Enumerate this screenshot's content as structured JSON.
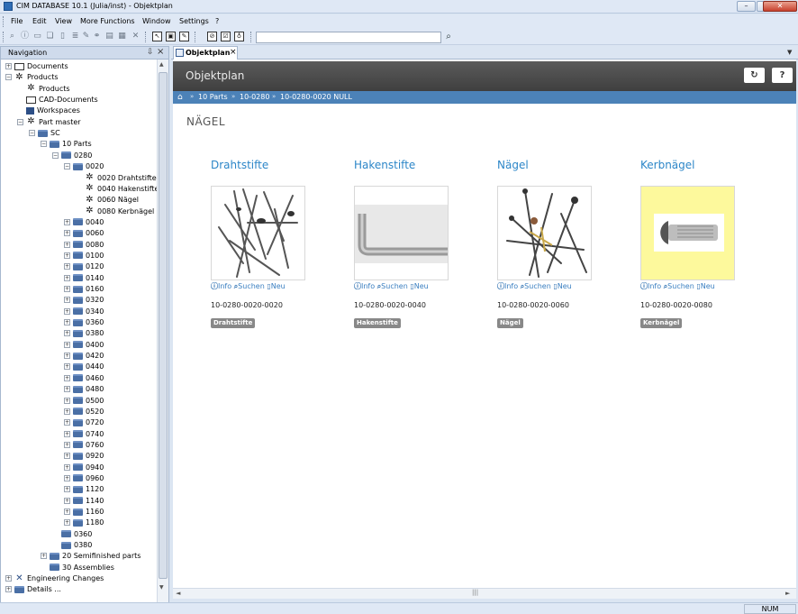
{
  "window": {
    "title": "CIM DATABASE 10.1 (Julia/inst) - Objektplan"
  },
  "menu": [
    "File",
    "Edit",
    "View",
    "More Functions",
    "Window",
    "Settings",
    "?"
  ],
  "toolbar": {
    "search_value": ""
  },
  "navigation": {
    "title": "Navigation",
    "nodes": [
      {
        "label": "Documents",
        "icon": "document-icon"
      },
      {
        "label": "Products",
        "icon": "gears-icon"
      },
      {
        "label": "Products",
        "icon": "gears-icon"
      },
      {
        "label": "CAD-Documents",
        "icon": "cad-icon"
      },
      {
        "label": "Workspaces",
        "icon": "workspace-icon"
      },
      {
        "label": "Part master",
        "icon": "gear-icon"
      },
      {
        "label": "SC",
        "icon": "folder-icon"
      },
      {
        "label": "10 Parts",
        "icon": "folder-icon"
      },
      {
        "label": "0280",
        "icon": "folder-icon"
      },
      {
        "label": "0020",
        "icon": "folder-icon"
      },
      {
        "label": "0020 Drahtstifte",
        "icon": "gear-icon"
      },
      {
        "label": "0040 Hakenstifte",
        "icon": "gear-icon"
      },
      {
        "label": "0060 Nägel",
        "icon": "gear-icon"
      },
      {
        "label": "0080 Kerbnägel",
        "icon": "gear-icon"
      },
      {
        "label": "0040"
      },
      {
        "label": "0060"
      },
      {
        "label": "0080"
      },
      {
        "label": "0100"
      },
      {
        "label": "0120"
      },
      {
        "label": "0140"
      },
      {
        "label": "0160"
      },
      {
        "label": "0320"
      },
      {
        "label": "0340"
      },
      {
        "label": "0360"
      },
      {
        "label": "0380"
      },
      {
        "label": "0400"
      },
      {
        "label": "0420"
      },
      {
        "label": "0440"
      },
      {
        "label": "0460"
      },
      {
        "label": "0480"
      },
      {
        "label": "0500"
      },
      {
        "label": "0520"
      },
      {
        "label": "0720"
      },
      {
        "label": "0740"
      },
      {
        "label": "0760"
      },
      {
        "label": "0920"
      },
      {
        "label": "0940"
      },
      {
        "label": "0960"
      },
      {
        "label": "1120"
      },
      {
        "label": "1140"
      },
      {
        "label": "1160"
      },
      {
        "label": "1180"
      },
      {
        "label": "0360"
      },
      {
        "label": "0380"
      },
      {
        "label": "20 Semifinished parts"
      },
      {
        "label": "30 Assemblies"
      },
      {
        "label": "Engineering Changes",
        "icon": "changes-icon"
      },
      {
        "label": "Details ..."
      }
    ]
  },
  "tab": {
    "label": "Objektplan"
  },
  "panel": {
    "title": "Objektplan",
    "refresh_icon": "refresh-icon",
    "help_label": "?",
    "breadcrumb": [
      "10 Parts",
      "10-0280",
      "10-0280-0020 NULL"
    ],
    "section_title": "NÄGEL",
    "cards": [
      {
        "title": "Drahtstifte",
        "info": "Info",
        "search": "Suchen",
        "new": "Neu",
        "number": "10-0280-0020-0020",
        "badge": "Drahtstifte"
      },
      {
        "title": "Hakenstifte",
        "info": "Info",
        "search": "Suchen",
        "new": "Neu",
        "number": "10-0280-0020-0040",
        "badge": "Hakenstifte"
      },
      {
        "title": "Nägel",
        "info": "Info",
        "search": "Suchen",
        "new": "Neu",
        "number": "10-0280-0020-0060",
        "badge": "Nägel"
      },
      {
        "title": "Kerbnägel",
        "info": "Info",
        "search": "Suchen",
        "new": "Neu",
        "number": "10-0280-0020-0080",
        "badge": "Kerbnägel"
      }
    ]
  },
  "status": {
    "num": "NUM"
  },
  "colors": {
    "accent": "#2c86c8",
    "breadcrumb_bg": "#4c82b8",
    "header_bg": "#4a4a4a",
    "badge_bg": "#888888"
  }
}
